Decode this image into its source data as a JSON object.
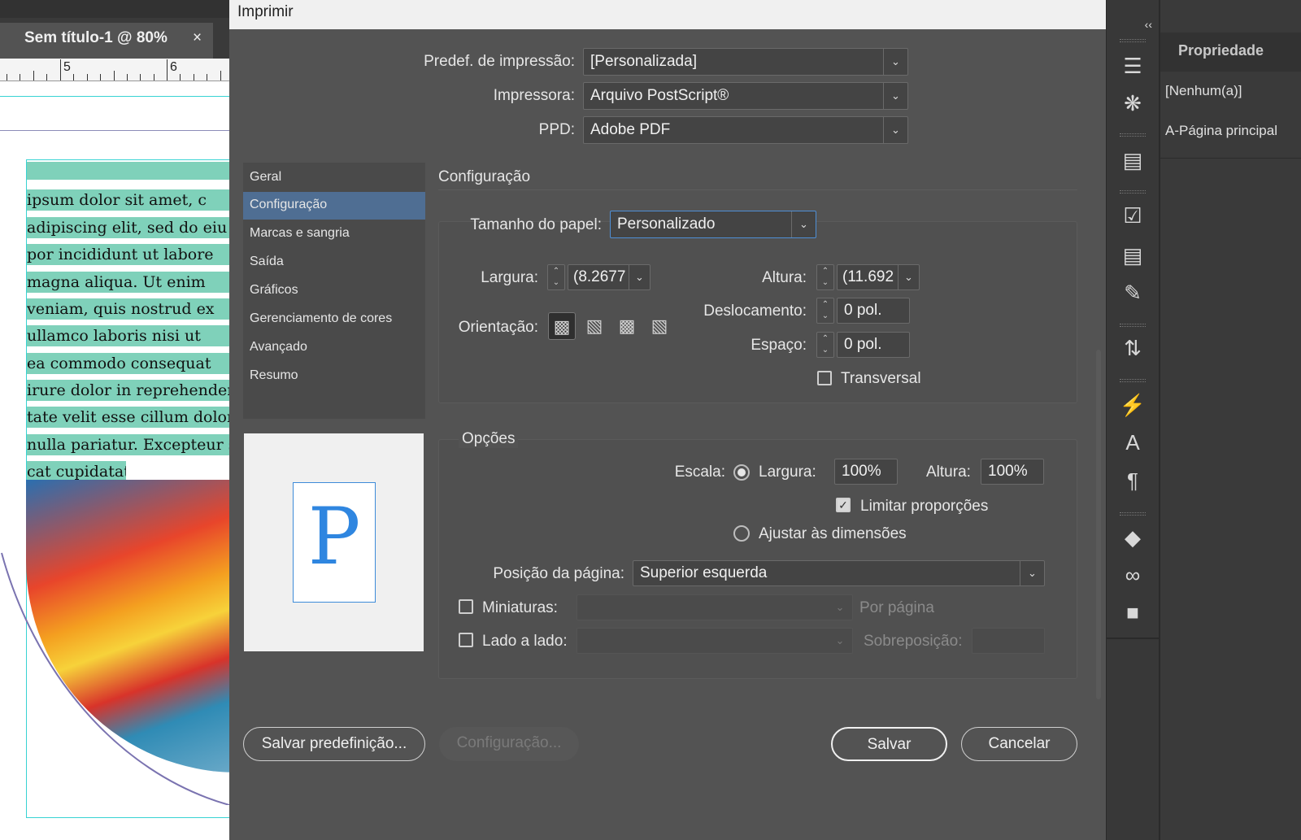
{
  "document": {
    "tab_label": "Sem título-1 @ 80%",
    "tab_close": "×",
    "ruler_labels": [
      "5",
      "6"
    ],
    "text_lines": [
      "",
      "ipsum dolor sit amet, c",
      "adipiscing elit, sed do eiu",
      "por incididunt ut labore",
      "magna aliqua. Ut enim",
      "veniam, quis nostrud ex",
      "ullamco laboris nisi ut",
      "ea commodo consequat",
      "irure dolor in reprehender",
      "tate velit esse cillum dolor",
      "nulla pariatur. Excepteur s",
      "cat cupidatat"
    ]
  },
  "dialog": {
    "title": "Imprimir",
    "preset": {
      "label": "Predef. de impressão:",
      "value": "[Personalizada]"
    },
    "printer": {
      "label": "Impressora:",
      "value": "Arquivo PostScript®"
    },
    "ppd": {
      "label": "PPD:",
      "value": "Adobe PDF"
    },
    "categories": [
      "Geral",
      "Configuração",
      "Marcas e sangria",
      "Saída",
      "Gráficos",
      "Gerenciamento de cores",
      "Avançado",
      "Resumo"
    ],
    "selected_category": "Configuração",
    "preview_glyph": "P",
    "section_title": "Configuração",
    "paper_size": {
      "label": "Tamanho do papel:",
      "value": "Personalizado"
    },
    "width": {
      "label": "Largura:",
      "value": "(8.2677"
    },
    "height": {
      "label": "Altura:",
      "value": "(11.692"
    },
    "orientation": {
      "label": "Orientação:",
      "icons": [
        "portrait-icon",
        "landscape-icon",
        "reverse-portrait-icon",
        "reverse-landscape-icon"
      ]
    },
    "offset": {
      "label": "Deslocamento:",
      "value": "0 pol."
    },
    "gap": {
      "label": "Espaço:",
      "value": "0 pol."
    },
    "transverse": {
      "label": "Transversal",
      "checked": false
    },
    "options": {
      "title": "Opções",
      "scale_label": "Escala:",
      "scale_width_label": "Largura:",
      "scale_width_value": "100%",
      "scale_height_label": "Altura:",
      "scale_height_value": "100%",
      "constrain_label": "Limitar proporções",
      "fit_label": "Ajustar às dimensões",
      "page_position_label": "Posição da página:",
      "page_position_value": "Superior esquerda",
      "thumbnails_label": "Miniaturas:",
      "per_page_label": "Por página",
      "tile_label": "Lado a lado:",
      "overlap_label": "Sobreposição:"
    },
    "buttons": {
      "save_preset": "Salvar predefinição...",
      "setup": "Configuração...",
      "save": "Salvar",
      "cancel": "Cancelar"
    }
  },
  "right_panel": {
    "collapse_glyph": "‹‹",
    "properties_title": "Propriedade",
    "items": [
      "[Nenhum(a)]",
      "A-Página principal"
    ],
    "icons": [
      "menu-icon",
      "swatches-icon",
      "comments-icon",
      "review-icon",
      "notes-icon",
      "edit-notes-icon",
      "sequence-icon",
      "cc-libraries-icon",
      "character-styles-icon",
      "paragraph-styles-icon",
      "layers-icon",
      "links-icon",
      "chat-icon"
    ]
  }
}
